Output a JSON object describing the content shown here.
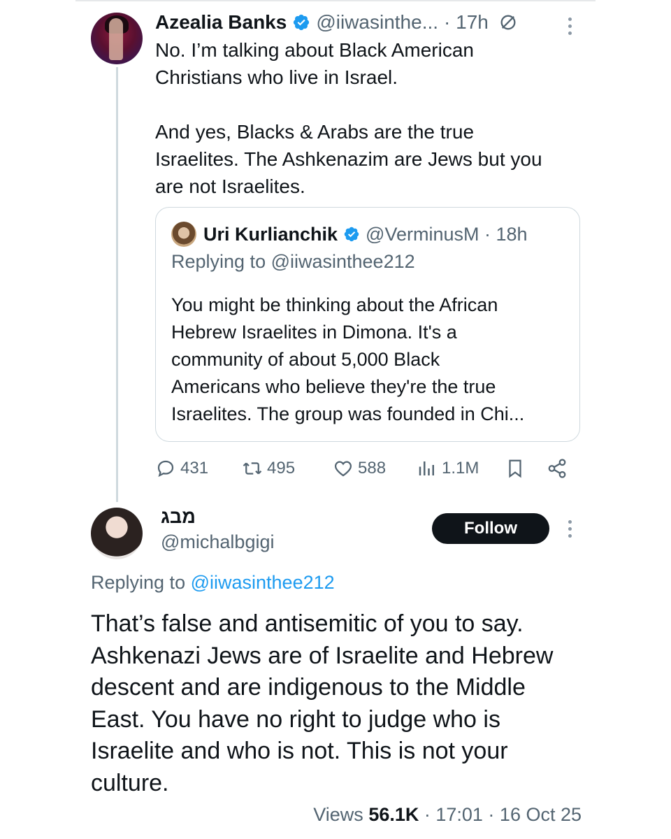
{
  "tweet1": {
    "name": "Azealia Banks",
    "handle": "@iiwasinthe...",
    "time": "· 17h",
    "lines1": [
      "No. I’m talking about Black American",
      "Christians who live in Israel."
    ],
    "lines2": [
      "And yes, Blacks & Arabs are the true",
      "Israelites. The Ashkenazim are Jews but you",
      "are not Israelites."
    ]
  },
  "quote": {
    "name": "Uri Kurlianchik",
    "handle": "@VerminusM · 18h",
    "replying": "Replying to @iiwasinthee212",
    "lines": [
      "You might be thinking about the African",
      "Hebrew Israelites in Dimona. It's a",
      "community of about 5,000 Black",
      "Americans who believe they're the true",
      "Israelites. The group was founded in Chi..."
    ]
  },
  "actions": {
    "replies": "431",
    "reposts": "495",
    "likes": "588",
    "views": "1.1M"
  },
  "tweet2": {
    "name": "מבג",
    "handle": "@michalbgigi",
    "follow_label": "Follow",
    "replying_prefix": "Replying to ",
    "replying_handle": "@iiwasinthee212",
    "lines": [
      "That’s false and antisemitic of you to say.",
      "Ashkenazi Jews are of Israelite and Hebrew",
      "descent and are indigenous to the Middle",
      "East. You have no right to judge who is",
      "Israelite and who is not. This is not your",
      "culture."
    ],
    "views_label": "Views ",
    "views_count": "56.1K",
    "timestamp": " · 17:01 · 16 Oct 25"
  },
  "colors": {
    "accent": "#1d9bf0",
    "text": "#0f1419",
    "muted": "#536471",
    "border": "#cfd9de"
  }
}
